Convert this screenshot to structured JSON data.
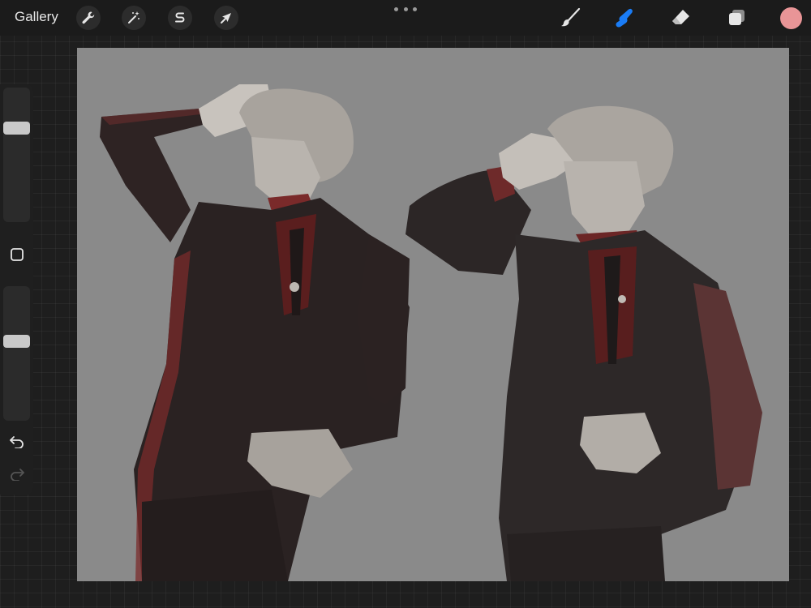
{
  "toolbar": {
    "gallery_label": "Gallery",
    "left_tools": [
      {
        "name": "actions",
        "icon": "wrench-icon"
      },
      {
        "name": "adjustments",
        "icon": "magic-wand-icon"
      },
      {
        "name": "selection",
        "icon": "selection-s-icon"
      },
      {
        "name": "transform",
        "icon": "arrow-cursor-icon"
      }
    ],
    "right_tools": [
      {
        "name": "brush",
        "icon": "brush-icon",
        "active": false
      },
      {
        "name": "smudge",
        "icon": "smudge-finger-icon",
        "active": true
      },
      {
        "name": "eraser",
        "icon": "eraser-icon",
        "active": false
      },
      {
        "name": "layers",
        "icon": "layers-icon",
        "active": false
      }
    ],
    "active_color": "#e99597",
    "accent_color": "#1a7cf5"
  },
  "sidebar": {
    "brush_size_level": 0.72,
    "opacity_level": 0.6,
    "buttons": [
      {
        "name": "modify",
        "icon": "square-icon"
      },
      {
        "name": "undo",
        "icon": "undo-icon"
      },
      {
        "name": "redo",
        "icon": "redo-icon",
        "enabled": false
      }
    ]
  },
  "canvas": {
    "background_color": "#8a8a8a",
    "artwork": "two-figures-in-dark-suits"
  }
}
